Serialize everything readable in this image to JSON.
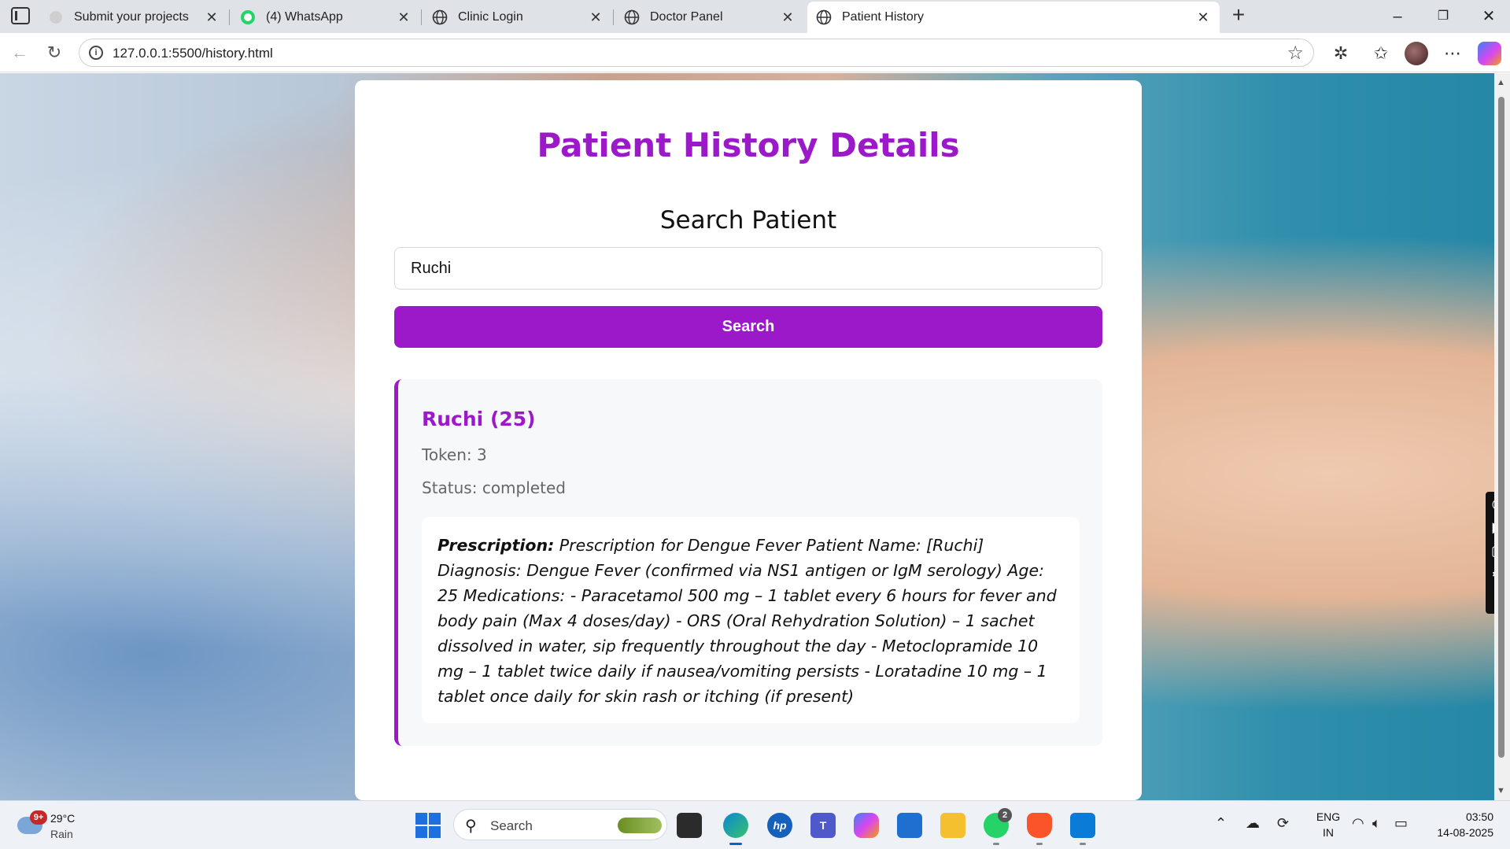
{
  "browser": {
    "tabs": [
      {
        "title": "Submit your projects",
        "icon": "generic-site-icon"
      },
      {
        "title": "(4) WhatsApp",
        "icon": "whatsapp-icon"
      },
      {
        "title": "Clinic Login",
        "icon": "globe-icon"
      },
      {
        "title": "Doctor Panel",
        "icon": "globe-icon"
      },
      {
        "title": "Patient History",
        "icon": "globe-icon",
        "active": true
      }
    ],
    "url": "127.0.0.1:5500/history.html"
  },
  "page": {
    "title": "Patient History Details",
    "search_heading": "Search Patient",
    "search_value": "Ruchi",
    "search_button": "Search",
    "result": {
      "name_line": "Ruchi (25)",
      "token_line": "Token: 3",
      "status_line": "Status: completed",
      "prescription_label": "Prescription:",
      "prescription_text": " Prescription for Dengue Fever Patient Name: [Ruchi] Diagnosis: Dengue Fever (confirmed via NS1 antigen or IgM serology) Age: 25 Medications: - Paracetamol 500 mg – 1 tablet every 6 hours for fever and body pain (Max 4 doses/day) - ORS (Oral Rehydration Solution) – 1 sachet dissolved in water, sip frequently throughout the day - Metoclopramide 10 mg – 1 tablet twice daily if nausea/vomiting persists - Loratadine 10 mg – 1 tablet once daily for skin rash or itching (if present)"
    }
  },
  "taskbar": {
    "weather_badge": "9+",
    "temperature": "29°C",
    "condition": "Rain",
    "search_label": "Search",
    "whatsapp_count": "2",
    "lang_top": "ENG",
    "lang_bottom": "IN",
    "time": "03:50",
    "date": "14-08-2025"
  },
  "colors": {
    "accent": "#9b19c9",
    "taskbar_bg": "#eef1f6"
  }
}
